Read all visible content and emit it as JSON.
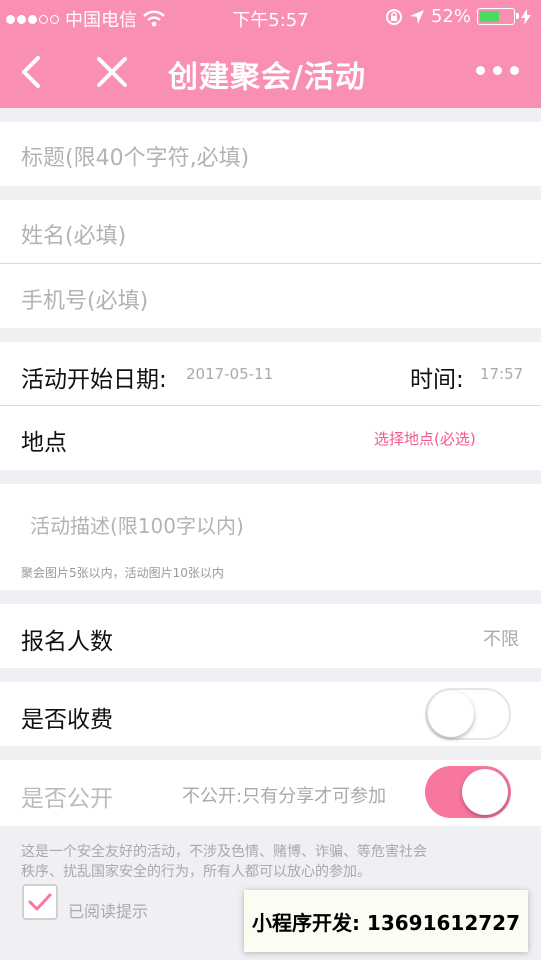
{
  "status_bar": {
    "carrier": "中国电信",
    "time": "下午5:57",
    "battery": "52%"
  },
  "nav": {
    "title": "创建聚会/活动"
  },
  "form": {
    "title_placeholder": "标题(限40个字符,必填)",
    "name_placeholder": "姓名(必填)",
    "phone_placeholder": "手机号(必填)",
    "start_date_label": "活动开始日期:",
    "start_date_value": "2017-05-11",
    "time_label": "时间:",
    "time_value": "17:57",
    "location_label": "地点",
    "location_action": "选择地点(必选)",
    "description_placeholder": "活动描述(限100字以内)",
    "image_hint": "聚会图片5张以内，活动图片10张以内",
    "signup_label": "报名人数",
    "signup_value": "不限",
    "fee_label": "是否收费",
    "fee_enabled": false,
    "public_label": "是否公开",
    "public_hint": "不公开:只有分享才可参加",
    "public_enabled": true,
    "notice_line1": "这是一个安全友好的活动，不涉及色情、赌博、诈骗、等危害社会",
    "notice_line2": "秩序、扰乱国家安全的行为，所有人都可以放心的参加。",
    "agree_label": "已阅读提示",
    "agree_checked": true
  },
  "watermark": "小程序开发: 13691612727",
  "colors": {
    "accent": "#f98fb3",
    "toggle_on": "#f7779f",
    "link": "#f45a8a",
    "check": "#f7779f"
  }
}
